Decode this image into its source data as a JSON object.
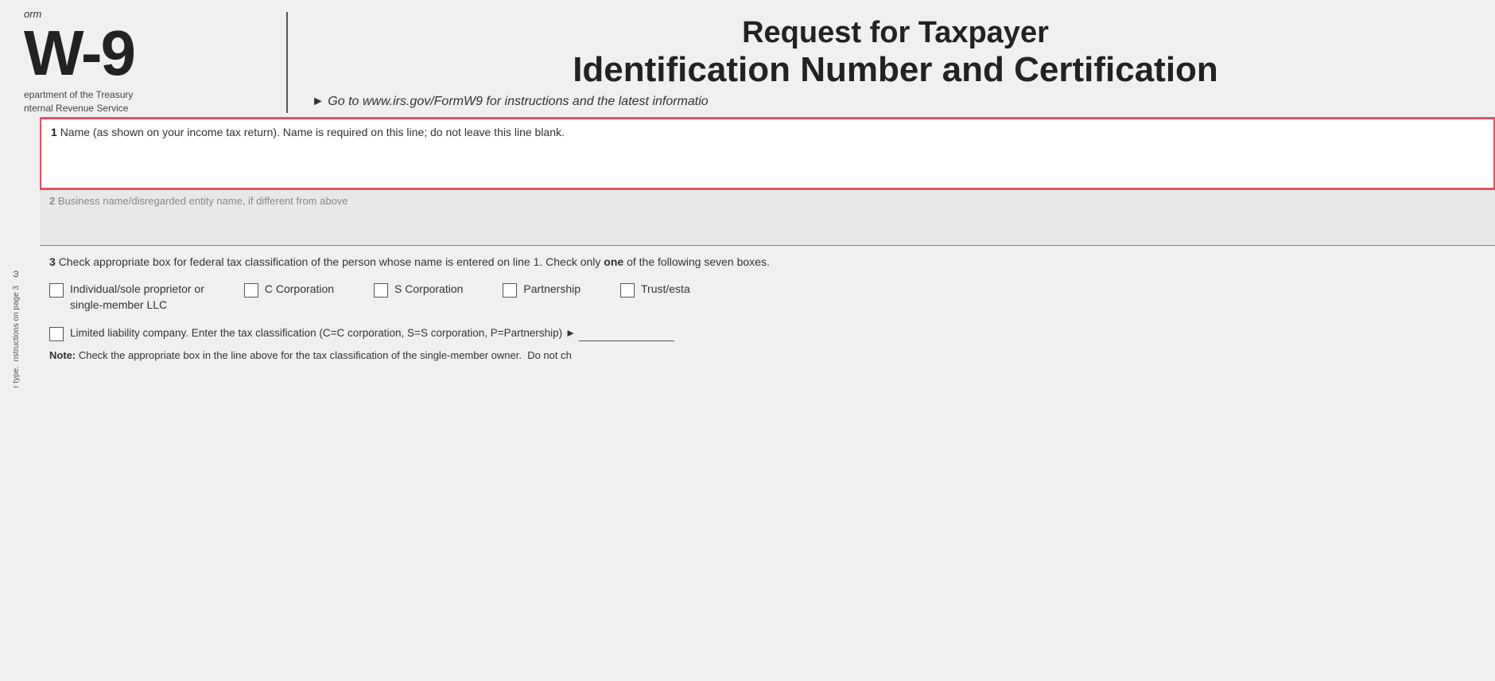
{
  "header": {
    "form_label": "orm",
    "form_number": "W-9",
    "dept_line1": "epartment of the Treasury",
    "dept_line2": "nternal Revenue Service",
    "title_line1": "Request for Taxpayer",
    "title_line2": "Identification Number and Certification",
    "irs_link": "► Go to www.irs.gov/FormW9 for instructions and the latest informatio"
  },
  "sidebar": {
    "rotated_text_1": "r type.",
    "rotated_text_2": "nstructions on page 3"
  },
  "fields": {
    "field1": {
      "number": "1",
      "label": "Name (as shown on your income tax return). Name is required on this line; do not leave this line blank."
    },
    "field2": {
      "number": "2",
      "label": "Business name/disregarded entity name, if different from above"
    },
    "field3": {
      "number": "3",
      "header": "Check appropriate box for federal tax classification of the person whose name is entered on line 1. Check only one of the following seven boxes.",
      "checkboxes": [
        {
          "id": "individual",
          "label": "Individual/sole proprietor or\nsingle-member LLC"
        },
        {
          "id": "c-corp",
          "label": "C Corporation"
        },
        {
          "id": "s-corp",
          "label": "S Corporation"
        },
        {
          "id": "partnership",
          "label": "Partnership"
        },
        {
          "id": "trust",
          "label": "Trust/esta"
        }
      ],
      "llc_label": "Limited liability company. Enter the tax classification (C=C corporation, S=S corporation, P=Partnership) ►",
      "note": "Note: Check the appropriate box in the line above for the tax classification of the single-member owner.  Do not ch"
    }
  }
}
